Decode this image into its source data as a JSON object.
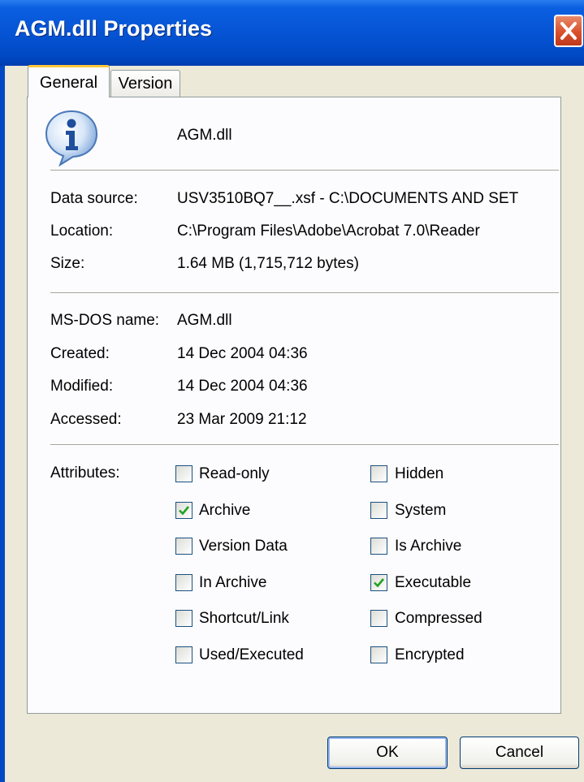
{
  "window": {
    "title": "AGM.dll Properties"
  },
  "tabs": [
    {
      "label": "General",
      "active": true
    },
    {
      "label": "Version",
      "active": false
    }
  ],
  "file": {
    "name": "AGM.dll",
    "icon": "info-icon",
    "data_source_label": "Data source:",
    "data_source_value": "USV3510BQ7__.xsf - C:\\DOCUMENTS AND SET",
    "location_label": "Location:",
    "location_value": "C:\\Program Files\\Adobe\\Acrobat 7.0\\Reader",
    "size_label": "Size:",
    "size_value": "1.64 MB (1,715,712 bytes)",
    "msdos_label": "MS-DOS name:",
    "msdos_value": "AGM.dll",
    "created_label": "Created:",
    "created_value": "14 Dec 2004 04:36",
    "modified_label": "Modified:",
    "modified_value": "14 Dec 2004 04:36",
    "accessed_label": "Accessed:",
    "accessed_value": "23 Mar 2009 21:12"
  },
  "attributes": {
    "label": "Attributes:",
    "left": [
      {
        "label": "Read-only",
        "checked": false
      },
      {
        "label": "Archive",
        "checked": true
      },
      {
        "label": "Version Data",
        "checked": false
      },
      {
        "label": "In Archive",
        "checked": false
      },
      {
        "label": "Shortcut/Link",
        "checked": false
      },
      {
        "label": "Used/Executed",
        "checked": false
      }
    ],
    "right": [
      {
        "label": "Hidden",
        "checked": false
      },
      {
        "label": "System",
        "checked": false
      },
      {
        "label": "Is Archive",
        "checked": false
      },
      {
        "label": "Executable",
        "checked": true
      },
      {
        "label": "Compressed",
        "checked": false
      },
      {
        "label": "Encrypted",
        "checked": false
      }
    ]
  },
  "buttons": {
    "ok": "OK",
    "cancel": "Cancel"
  },
  "colors": {
    "titlebar": "#0654d4",
    "check": "#21a121",
    "close": "#d9502c"
  }
}
